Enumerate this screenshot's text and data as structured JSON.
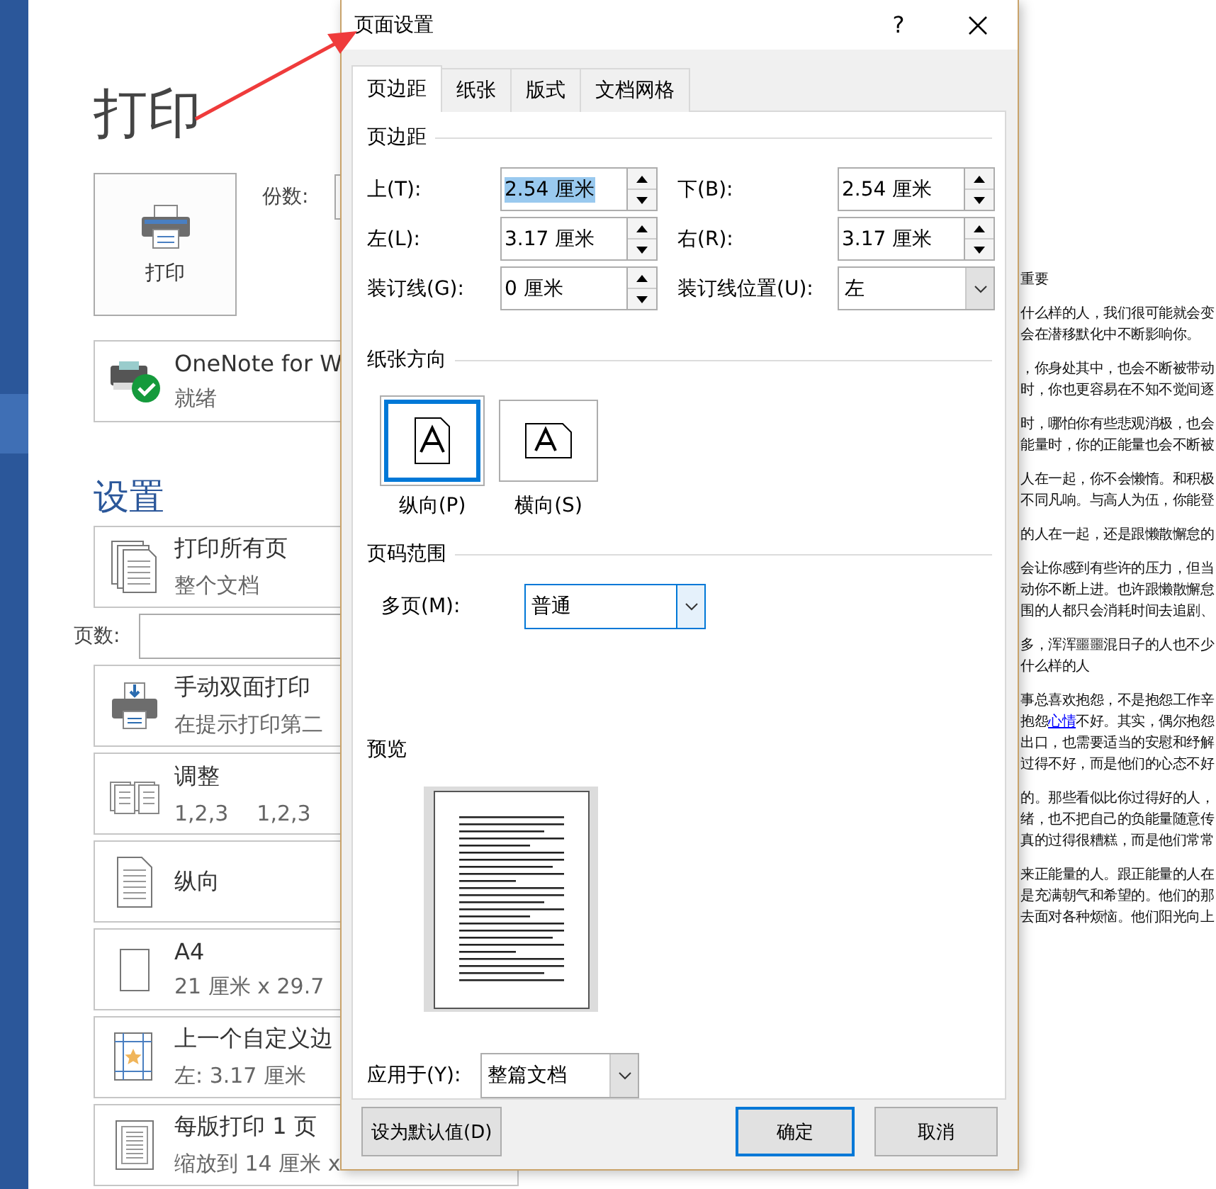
{
  "backstage": {
    "title": "打印",
    "print_button": "打印",
    "copies_label": "份数:",
    "printer": {
      "name": "OneNote for W",
      "status": "就绪"
    },
    "settings_heading": "设置",
    "settings": [
      {
        "kind": "pages",
        "title": "打印所有页",
        "details": [
          "整个文档"
        ]
      },
      {
        "kind": "field",
        "title": "页数:"
      },
      {
        "kind": "duplex",
        "title": "手动双面打印",
        "details": [
          "在提示打印第二"
        ]
      },
      {
        "kind": "collate",
        "title": "调整",
        "details": [
          "1,2,3",
          "1,2,3"
        ]
      },
      {
        "kind": "portrait",
        "title": "纵向"
      },
      {
        "kind": "paper",
        "title": "A4",
        "details": [
          "21 厘米 x 29.7"
        ]
      },
      {
        "kind": "margins",
        "title": "上一个自定义边",
        "details": [
          "左: 3.17 厘米"
        ]
      },
      {
        "kind": "per-sheet",
        "title": "每版打印 1 页",
        "details": [
          "缩放到 14 厘米 x"
        ]
      }
    ]
  },
  "document_paragraphs": [
    [
      [
        {
          "kind": "text",
          "text": "重要"
        }
      ]
    ],
    [
      [
        {
          "kind": "text",
          "text": "什么样的人，我们很可能就会变"
        }
      ],
      [
        {
          "kind": "text",
          "text": "会在潜移默化中不断影响你。"
        }
      ]
    ],
    [
      [
        {
          "kind": "text",
          "text": "，你身处其中，也会不断被带动"
        }
      ],
      [
        {
          "kind": "text",
          "text": "时，你也更容易在不知不觉间逐"
        }
      ]
    ],
    [
      [
        {
          "kind": "text",
          "text": "时，哪怕你有些悲观消极，也会"
        }
      ],
      [
        {
          "kind": "text",
          "text": "能量时，你的正能量也会不断被"
        }
      ]
    ],
    [
      [
        {
          "kind": "text",
          "text": "人在一起，你不会懒惰。和积极"
        }
      ],
      [
        {
          "kind": "text",
          "text": "不同凡响。与高人为伍，你能登"
        }
      ]
    ],
    [
      [
        {
          "kind": "text",
          "text": "的人在一起，还是跟懒散懈怠的"
        }
      ]
    ],
    [
      [
        {
          "kind": "text",
          "text": "会让你感到有些许的压力，但当"
        }
      ],
      [
        {
          "kind": "text",
          "text": "动你不断上进。也许跟懒散懈怠"
        }
      ],
      [
        {
          "kind": "text",
          "text": "围的人都只会消耗时间去追剧、"
        }
      ]
    ],
    [
      [
        {
          "kind": "text",
          "text": "多，浑浑噩噩混日子的人也不少"
        }
      ],
      [
        {
          "kind": "text",
          "text": "什么样的人"
        }
      ]
    ],
    [
      [
        {
          "kind": "text",
          "text": "事总喜欢抱怨，不是抱怨工作辛"
        }
      ],
      [
        {
          "kind": "text",
          "text": "抱怨"
        },
        {
          "kind": "link",
          "text": "心情"
        },
        {
          "kind": "text",
          "text": "不好。其实，偶尔抱怨"
        }
      ],
      [
        {
          "kind": "text",
          "text": "出口，也需要适当的安慰和纾解"
        }
      ],
      [
        {
          "kind": "text",
          "text": "过得不好，而是他们的心态不好"
        }
      ]
    ],
    [
      [
        {
          "kind": "text",
          "text": "的。那些看似比你过得好的人，"
        }
      ],
      [
        {
          "kind": "text",
          "text": "绪，也不把自己的负能量随意传"
        }
      ],
      [
        {
          "kind": "text",
          "text": "真的过得很糟糕，而是他们常常"
        }
      ]
    ],
    [
      [
        {
          "kind": "text",
          "text": "来正能量的人。跟正能量的人在"
        }
      ],
      [
        {
          "kind": "text",
          "text": "是充满朝气和希望的。他们的那"
        }
      ],
      [
        {
          "kind": "text",
          "text": "去面对各种烦恼。他们阳光向上"
        }
      ]
    ]
  ],
  "dialog": {
    "title": "页面设置",
    "help": "?",
    "tabs": [
      {
        "label": "页边距",
        "selected": true
      },
      {
        "label": "纸张",
        "selected": false
      },
      {
        "label": "版式",
        "selected": false
      },
      {
        "label": "文档网格",
        "selected": false
      }
    ],
    "margins_heading": "页边距",
    "margin_fields": [
      {
        "kind": "spinner",
        "label": "上(T):",
        "value": "2.54 厘米",
        "highlighted": true
      },
      {
        "kind": "spinner",
        "label": "下(B):",
        "value": "2.54 厘米",
        "highlighted": false
      },
      {
        "kind": "spinner",
        "label": "左(L):",
        "value": "3.17 厘米",
        "highlighted": false
      },
      {
        "kind": "spinner",
        "label": "右(R):",
        "value": "3.17 厘米",
        "highlighted": false
      },
      {
        "kind": "spinner",
        "label": "装订线(G):",
        "value": "0 厘米",
        "highlighted": false
      },
      {
        "kind": "dropdown",
        "label": "装订线位置(U):",
        "value": "左",
        "focused": false
      }
    ],
    "orientation_heading": "纸张方向",
    "orientations": [
      {
        "kind": "portrait",
        "label": "纵向(P)",
        "selected": true
      },
      {
        "kind": "landscape",
        "label": "横向(S)",
        "selected": false
      }
    ],
    "pages_heading": "页码范围",
    "multiple_pages": {
      "label": "多页(M):",
      "value": "普通",
      "focused": true
    },
    "preview_heading": "预览",
    "apply_to": {
      "label": "应用于(Y):",
      "value": "整篇文档",
      "focused": false
    },
    "buttons": [
      {
        "label": "设为默认值(D)",
        "default": false
      },
      {
        "label": "确定",
        "default": true
      },
      {
        "label": "取消",
        "default": false
      }
    ]
  }
}
